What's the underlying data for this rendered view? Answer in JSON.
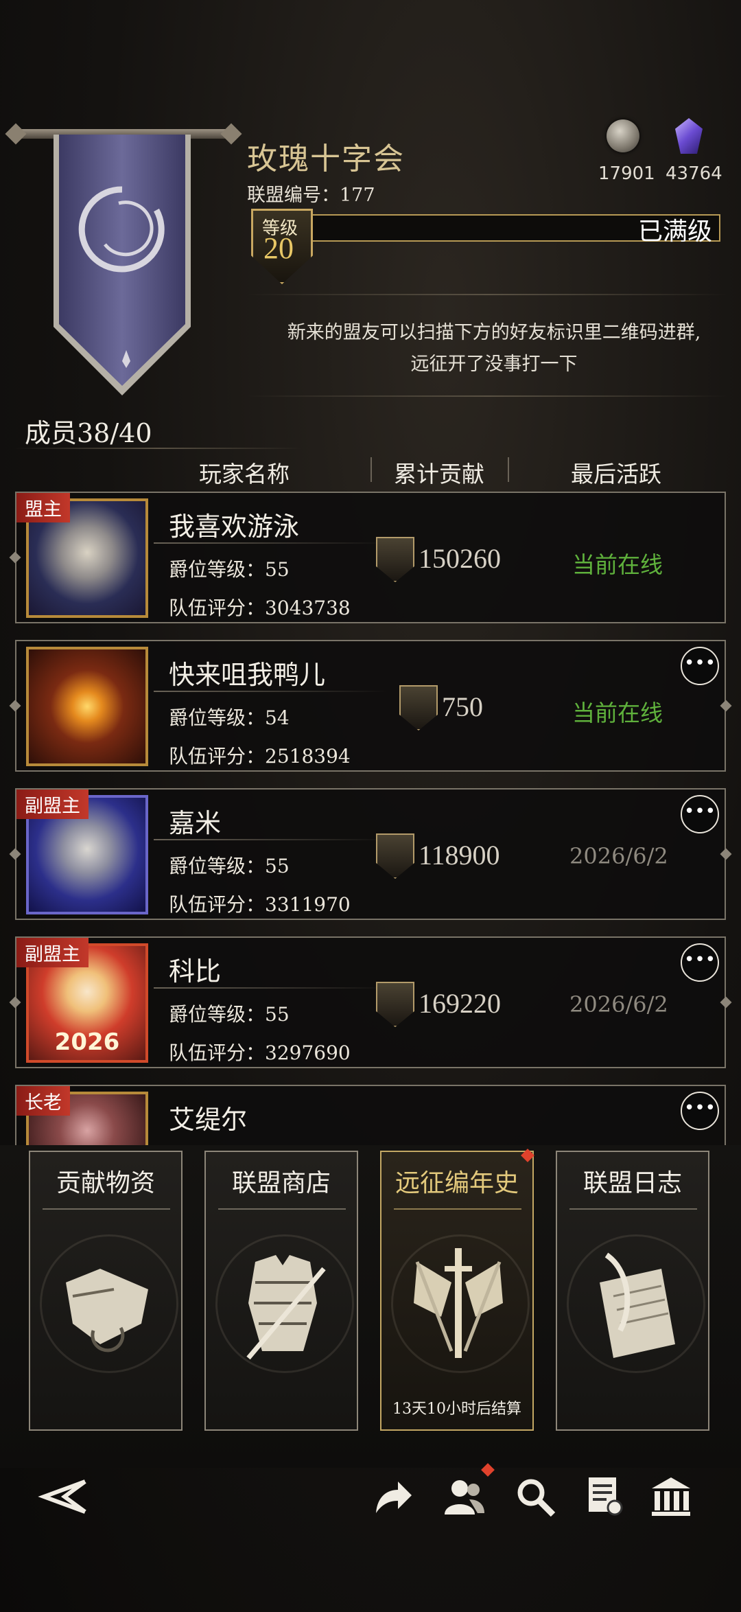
{
  "guild": {
    "name": "玫瑰十字会",
    "id_label": "联盟编号：177",
    "level_tag": "等级",
    "level": "20",
    "level_status": "已满级",
    "notice_line1": "新来的盟友可以扫描下方的好友标识里二维码进群,",
    "notice_line2": "远征开了没事打一下",
    "members": "成员38/40"
  },
  "resources": {
    "silver": "17901",
    "gems": "43764"
  },
  "columns": {
    "player": "玩家名称",
    "contribution": "累计贡献",
    "last_active": "最后活跃"
  },
  "rows": [
    {
      "role": "盟主",
      "name": "我喜欢游泳",
      "rank_label": "爵位等级：",
      "rank": "55",
      "score_label": "队伍评分：",
      "score": "3043738",
      "contribution": "150260",
      "active": "当前在线"
    },
    {
      "role": "",
      "name": "快来咀我鸭儿",
      "rank_label": "爵位等级：",
      "rank": "54",
      "score_label": "队伍评分：",
      "score": "2518394",
      "contribution": "750",
      "active": "当前在线"
    },
    {
      "role": "副盟主",
      "name": "嘉米",
      "rank_label": "爵位等级：",
      "rank": "55",
      "score_label": "队伍评分：",
      "score": "3311970",
      "contribution": "118900",
      "active": "2026/6/2"
    },
    {
      "role": "副盟主",
      "name": "科比",
      "rank_label": "爵位等级：",
      "rank": "55",
      "score_label": "队伍评分：",
      "score": "3297690",
      "contribution": "169220",
      "active": "2026/6/2"
    },
    {
      "role": "长老",
      "name": "艾缇尔"
    }
  ],
  "avatar_badge": "2026",
  "cards": [
    {
      "title": "贡献物资"
    },
    {
      "title": "联盟商店"
    },
    {
      "title": "远征编年史",
      "footer": "13天10小时后结算"
    },
    {
      "title": "联盟日志"
    }
  ],
  "colors": {
    "gold": "#d8c594",
    "online": "#5fb13c",
    "role_red": "#b32a20"
  },
  "nav_icons": [
    "back-icon",
    "share-icon",
    "members-icon",
    "search-icon",
    "document-icon",
    "bank-icon"
  ]
}
